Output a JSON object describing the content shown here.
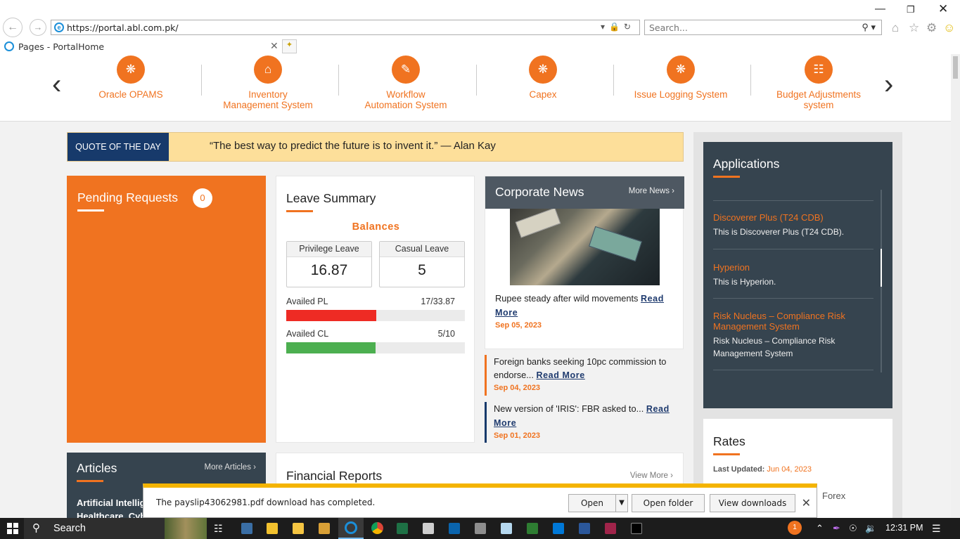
{
  "browser": {
    "url": "https://portal.abl.com.pk/",
    "search_placeholder": "Search...",
    "tab_title": "Pages - PortalHome"
  },
  "app_carousel": {
    "items": [
      {
        "label_line1": "Oracle OPAMS",
        "label_line2": "",
        "icon": "network-icon"
      },
      {
        "label_line1": "Inventory",
        "label_line2": "Management System",
        "icon": "hand-house-icon"
      },
      {
        "label_line1": "Workflow",
        "label_line2": "Automation System",
        "icon": "document-gear-icon"
      },
      {
        "label_line1": "Capex",
        "label_line2": "",
        "icon": "network-icon"
      },
      {
        "label_line1": "Issue Logging System",
        "label_line2": "",
        "icon": "network-icon"
      },
      {
        "label_line1": "Budget Adjustments",
        "label_line2": "system",
        "icon": "hierarchy-icon"
      }
    ]
  },
  "quote": {
    "tag": "QUOTE OF THE DAY",
    "text": "“The best way to predict the future is to invent it.” — Alan Kay"
  },
  "pending": {
    "title": "Pending Requests",
    "count": "0"
  },
  "leave": {
    "title": "Leave Summary",
    "balances_label": "Balances",
    "privilege_label": "Privilege Leave",
    "privilege_value": "16.87",
    "casual_label": "Casual Leave",
    "casual_value": "5",
    "availed_pl_label": "Availed PL",
    "availed_pl_value": "17/33.87",
    "availed_pl_fraction": 0.502,
    "availed_cl_label": "Availed CL",
    "availed_cl_value": "5/10",
    "availed_cl_fraction": 0.5
  },
  "news": {
    "title": "Corporate News",
    "more": "More News",
    "items": [
      {
        "text": "Rupee steady after wild movements",
        "read_more": "Read More",
        "date": "Sep 05, 2023"
      },
      {
        "text": "Foreign banks seeking 10pc commission to endorse...",
        "read_more": "Read More",
        "date": "Sep 04, 2023"
      },
      {
        "text": "New version of 'IRIS': FBR asked to...",
        "read_more": "Read More",
        "date": "Sep 01, 2023"
      }
    ]
  },
  "applications": {
    "title": "Applications",
    "items": [
      {
        "title": "Discoverer Plus (T24 CDB)",
        "desc": "This is Discoverer Plus (T24 CDB)."
      },
      {
        "title": "Hyperion",
        "desc": "This is Hyperion."
      },
      {
        "title": "Risk Nucleus – Compliance Risk Management System",
        "desc": "Risk Nucleus – Compliance Risk Management System"
      }
    ]
  },
  "articles": {
    "title": "Articles",
    "more": "More Articles",
    "first_line1": "Artificial Intelligence",
    "first_line2": "Healthcare, Cybersecurity"
  },
  "financial": {
    "title": "Financial Reports",
    "more": "View More"
  },
  "rates": {
    "title": "Rates",
    "last_updated_label": "Last Updated:",
    "last_updated_value": "Jun 04, 2023",
    "forex": "Forex"
  },
  "download": {
    "message": "The payslip43062981.pdf download has completed.",
    "open": "Open",
    "open_folder": "Open folder",
    "view_downloads": "View downloads"
  },
  "taskbar": {
    "search": "Search",
    "time": "12:31 PM",
    "notification_count": "1"
  },
  "colors": {
    "accent": "#f07320",
    "navy": "#173a6b",
    "panel": "#36444f",
    "quote_bg": "#fddf9a",
    "pl_bar": "#ee2b24",
    "cl_bar": "#4caf50"
  }
}
